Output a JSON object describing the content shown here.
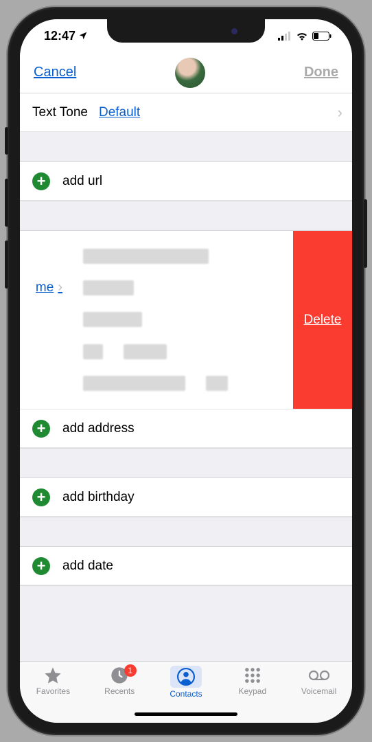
{
  "status": {
    "time": "12:47"
  },
  "nav": {
    "cancel": "Cancel",
    "done": "Done"
  },
  "texttone": {
    "label": "Text Tone",
    "value": "Default"
  },
  "add": {
    "url": "add url",
    "address": "add address",
    "birthday": "add birthday",
    "date": "add date"
  },
  "swipe": {
    "home_partial": "me",
    "delete": "Delete"
  },
  "tabs": {
    "favorites": "Favorites",
    "recents": "Recents",
    "recents_badge": "1",
    "contacts": "Contacts",
    "keypad": "Keypad",
    "voicemail": "Voicemail"
  }
}
